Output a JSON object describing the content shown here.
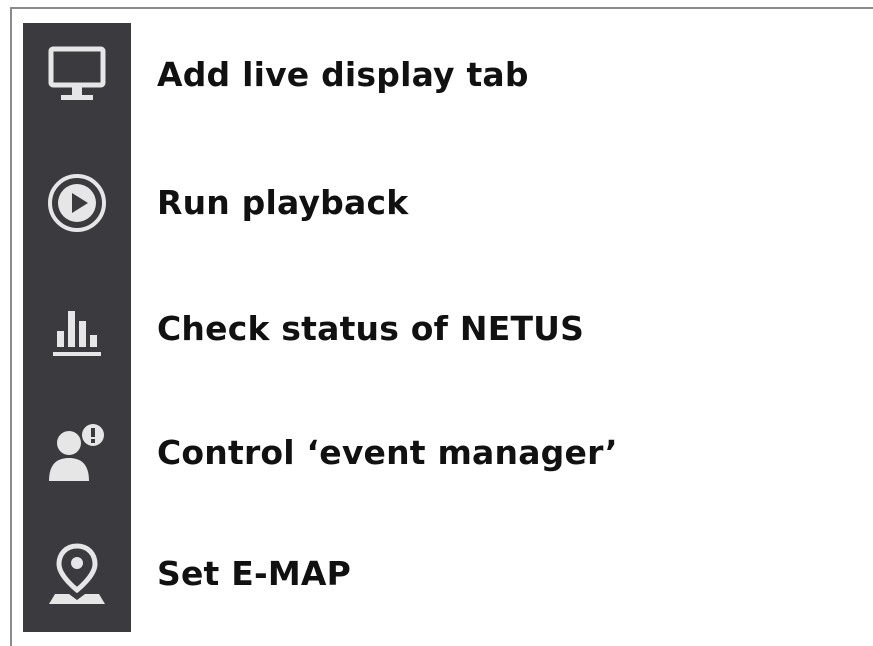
{
  "legend": {
    "items": [
      {
        "icon": "monitor-icon",
        "label": "Add live display tab"
      },
      {
        "icon": "play-circle-icon",
        "label": "Run playback"
      },
      {
        "icon": "bar-chart-icon",
        "label": "Check status of NETUS"
      },
      {
        "icon": "user-alert-icon",
        "label": "Control ‘event manager’"
      },
      {
        "icon": "map-pin-icon",
        "label": "Set E-MAP"
      }
    ]
  },
  "colors": {
    "sidebar_bg": "#3b3a3f",
    "icon_fg": "#e6e6e6",
    "text": "#111111"
  }
}
